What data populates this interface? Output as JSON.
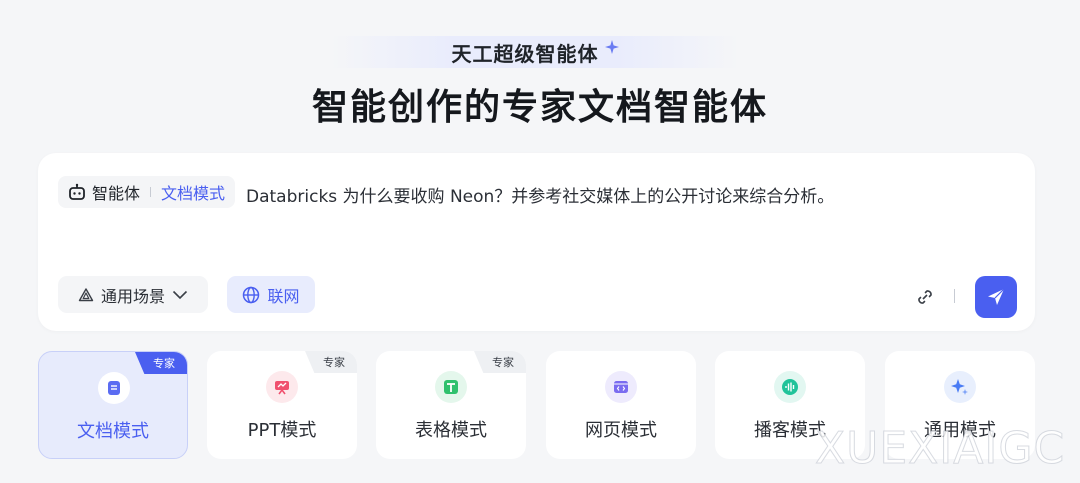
{
  "header": {
    "tagline": "天工超级智能体",
    "title": "智能创作的专家文档智能体"
  },
  "composer": {
    "agent_label": "智能体",
    "agent_mode": "文档模式",
    "prompt": "Databricks 为什么要收购 Neon？并参考社交媒体上的公开讨论来综合分析。",
    "scene_label": "通用场景",
    "web_label": "联网",
    "icons": {
      "agent": "robot-icon",
      "scene": "triangle-icon",
      "web": "globe-icon",
      "attach": "link-icon",
      "send": "paper-plane-icon"
    },
    "accent_color": "#4a5ff0"
  },
  "modes": [
    {
      "label": "文档模式",
      "badge": "专家",
      "icon": "document-icon",
      "color": "#5b6cf2",
      "active": true
    },
    {
      "label": "PPT模式",
      "badge": "专家",
      "icon": "presentation-icon",
      "color": "#f0506e",
      "active": false
    },
    {
      "label": "表格模式",
      "badge": "专家",
      "icon": "table-icon",
      "color": "#2fc16d",
      "active": false
    },
    {
      "label": "网页模式",
      "badge": "",
      "icon": "code-window-icon",
      "color": "#7a6cf0",
      "active": false
    },
    {
      "label": "播客模式",
      "badge": "",
      "icon": "audio-wave-icon",
      "color": "#20c39a",
      "active": false
    },
    {
      "label": "通用模式",
      "badge": "",
      "icon": "sparkle-icon",
      "color": "#4a7cf5",
      "active": false
    }
  ],
  "watermark": "XUEXIAIGC"
}
